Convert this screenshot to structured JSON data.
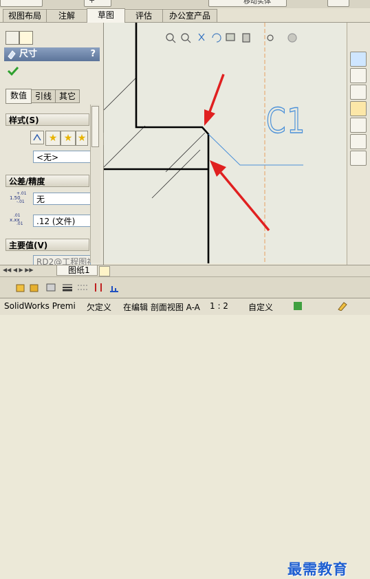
{
  "tabs": [
    "视图布局",
    "注解",
    "草图",
    "评估",
    "办公室产品"
  ],
  "active_tab": "草图",
  "top_partial_label": "移动实体",
  "property_manager": {
    "title": "尺寸",
    "help": "?",
    "subtabs": [
      "数值",
      "引线",
      "其它"
    ],
    "groups": {
      "style": "样式(S)",
      "tolerance": "公差/精度",
      "primary": "主要值(V)"
    },
    "style_dropdown": "<无>",
    "tolerance_type": "无",
    "tolerance_icon_text": [
      "+.01",
      "1.50",
      "-.01"
    ],
    "precision_icon_text": [
      "x.xx",
      ".01",
      ".01"
    ],
    "precision_value": ".12 (文件)",
    "primary_value_field": "RD2@工程图视"
  },
  "canvas": {
    "annotation_text": "C1"
  },
  "sheet_tab": "图纸1",
  "status_bar": {
    "app": "SolidWorks Premi",
    "state": "欠定义",
    "edit": "在编辑 剖面视图 A-A",
    "scale": "1 : 2",
    "custom": "自定义"
  },
  "watermark": "最需教育",
  "colors": {
    "annotation_blue": "#4A90D9",
    "arrow_red": "#E02020",
    "geometry_black": "#000000",
    "centerline_orange": "#E6A060"
  }
}
